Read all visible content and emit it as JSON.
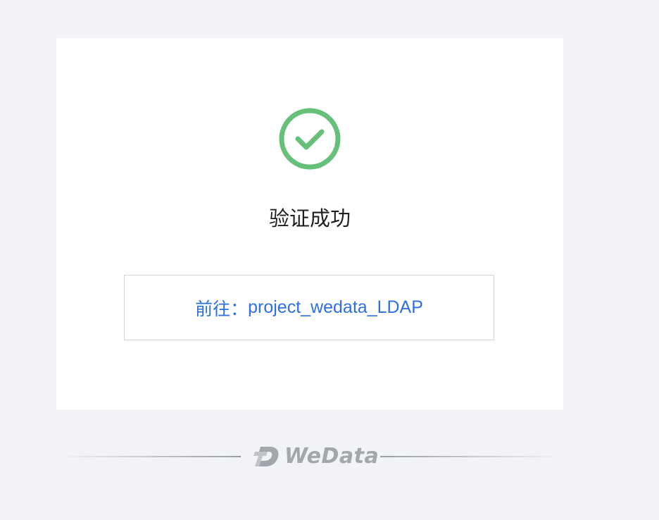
{
  "status": {
    "icon": "check-circle-icon",
    "title": "验证成功",
    "color": "#67c07a"
  },
  "goto": {
    "label": "前往：",
    "project": "project_wedata_LDAP",
    "color": "#2f6fe4"
  },
  "footer": {
    "brand_icon": "wedata-logo-icon",
    "brand_name": "WeData"
  }
}
